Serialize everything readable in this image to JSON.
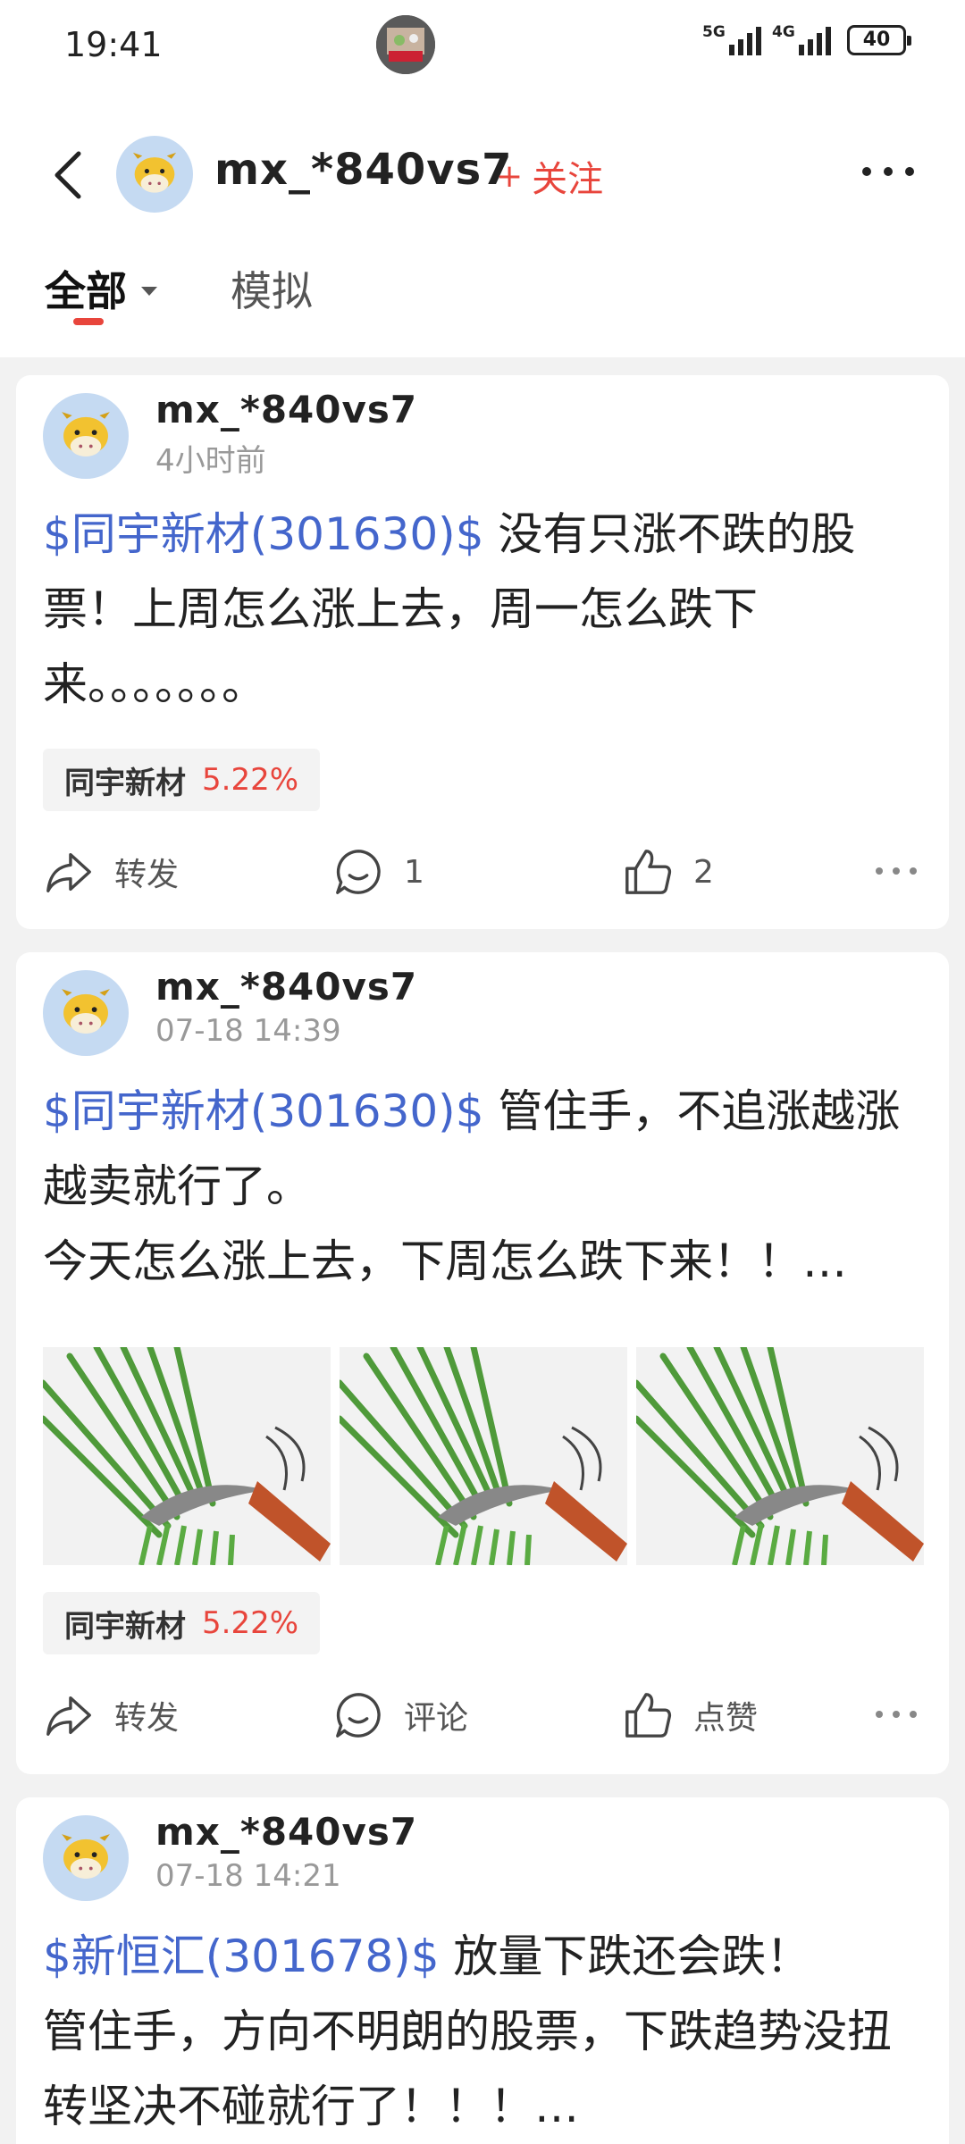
{
  "status_bar": {
    "time": "19:41",
    "network1": "5G",
    "network2": "4G",
    "battery": "40"
  },
  "header": {
    "username": "mx_*840vs7",
    "follow_label": "关注",
    "follow_plus": "+"
  },
  "tabs": {
    "all": "全部",
    "simulated": "模拟"
  },
  "posts": [
    {
      "author": "mx_*840vs7",
      "time": "4小时前",
      "stock_tag": "$同宇新材(301630)$",
      "text": " 没有只涨不跌的股票！上周怎么涨上去，周一怎么跌下来。。。。。。。",
      "chip": {
        "name": "同宇新材",
        "pct": "5.22%"
      },
      "actions": {
        "forward": "转发",
        "comment": "1",
        "like": "2"
      }
    },
    {
      "author": "mx_*840vs7",
      "time": "07-18 14:39",
      "stock_tag": "$同宇新材(301630)$",
      "text": " 管住手，不追涨越涨越卖就行了。",
      "text2": "今天怎么涨上去，下周怎么跌下来！！…",
      "chip": {
        "name": "同宇新材",
        "pct": "5.22%"
      },
      "actions": {
        "forward": "转发",
        "comment": "评论",
        "like": "点赞"
      }
    },
    {
      "author": "mx_*840vs7",
      "time": "07-18 14:21",
      "stock_tag": "$新恒汇(301678)$",
      "text": " 放量下跌还会跌！",
      "text2": "管住手，方向不明朗的股票，下跌趋势没扭转坚决不碰就行了！！！…"
    }
  ]
}
